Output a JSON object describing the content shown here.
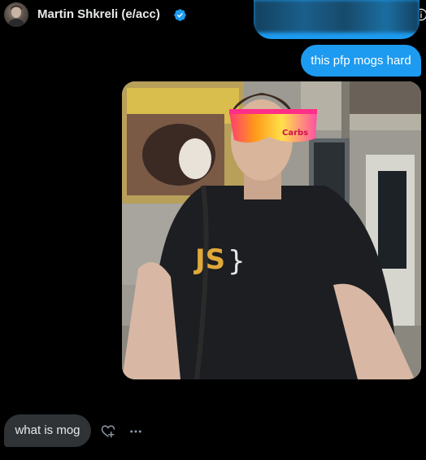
{
  "header": {
    "display_name": "Martin Shkreli (e/acc)",
    "verified_icon": "verified-badge-icon",
    "avatar_icon": "user-avatar",
    "info_icon": "info-icon"
  },
  "messages": [
    {
      "direction": "outgoing",
      "text": "this pfp mogs hard"
    },
    {
      "direction": "outgoing",
      "attachment": "photo",
      "sticker_text": "Carbs"
    },
    {
      "direction": "incoming",
      "text": "what is mog"
    }
  ],
  "message_actions": {
    "react_icon": "heart-plus-icon",
    "more_icon": "more-horizontal-icon"
  },
  "colors": {
    "background": "#000000",
    "outgoing_bubble": "#1d9bf0",
    "incoming_bubble": "#2f3336",
    "verified": "#1d9bf0",
    "text": "#e7e9ea"
  }
}
